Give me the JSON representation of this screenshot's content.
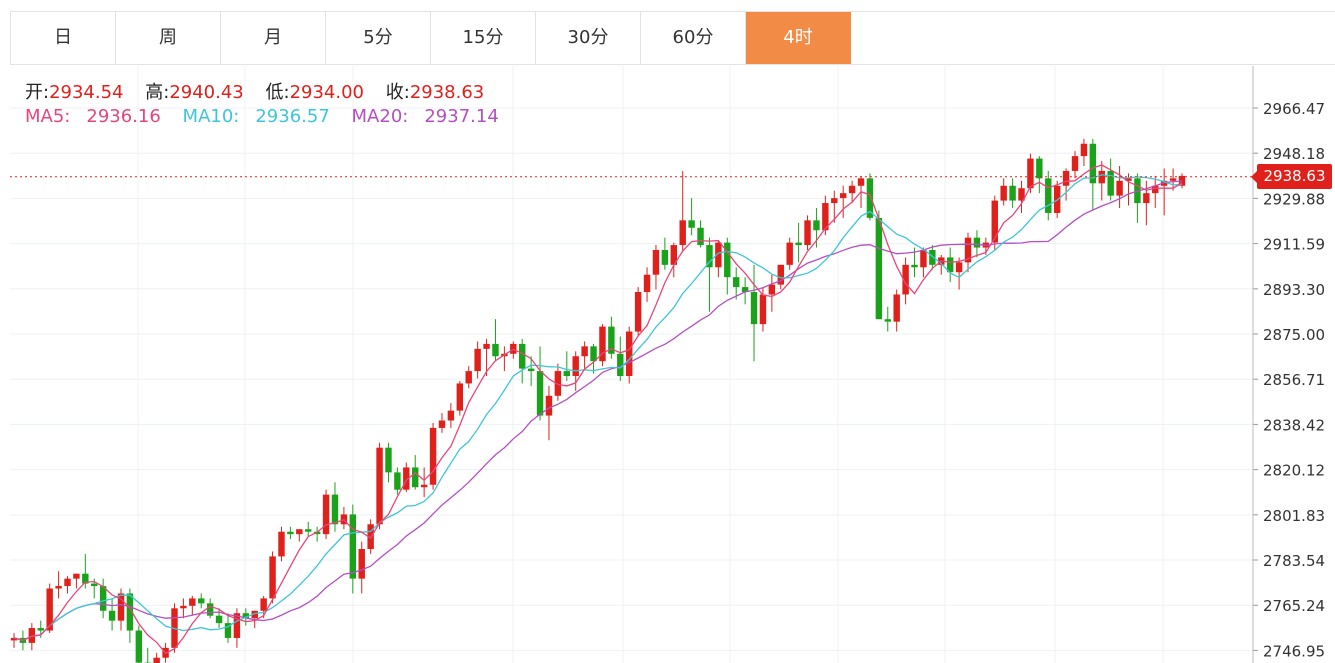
{
  "tabs": [
    {
      "label": "日",
      "active": false
    },
    {
      "label": "周",
      "active": false
    },
    {
      "label": "月",
      "active": false
    },
    {
      "label": "5分",
      "active": false
    },
    {
      "label": "15分",
      "active": false
    },
    {
      "label": "30分",
      "active": false
    },
    {
      "label": "60分",
      "active": false
    },
    {
      "label": "4时",
      "active": true
    }
  ],
  "ohlc_info": {
    "open_label": "开:",
    "open": "2934.54",
    "high_label": "高:",
    "high": "2940.43",
    "low_label": "低:",
    "low": "2934.00",
    "close_label": "收:",
    "close": "2938.63"
  },
  "ma_info": {
    "ma5_label": "MA5:",
    "ma5": "2936.16",
    "ma10_label": "MA10:",
    "ma10": "2936.57",
    "ma20_label": "MA20:",
    "ma20": "2937.14"
  },
  "current_price": "2938.63",
  "colors": {
    "up": "#e0201b",
    "down": "#1aa31a",
    "ma5": "#e8467a",
    "ma10": "#3ec6d6",
    "ma20": "#b44fc4",
    "accent": "#f28b45"
  },
  "chart_data": {
    "type": "candlestick",
    "y_axis_labels": [
      "2966.47",
      "2948.18",
      "2929.88",
      "2911.59",
      "2893.30",
      "2875.00",
      "2856.71",
      "2838.42",
      "2820.12",
      "2801.83",
      "2783.54",
      "2765.24",
      "2746.95"
    ],
    "ylim": [
      2742,
      2976
    ],
    "grid": true,
    "current_price": 2938.63,
    "candles": [
      [
        2751,
        2754,
        2748,
        2752
      ],
      [
        2752,
        2755,
        2747,
        2750
      ],
      [
        2750,
        2758,
        2747,
        2756
      ],
      [
        2756,
        2759,
        2752,
        2755
      ],
      [
        2755,
        2774,
        2754,
        2772
      ],
      [
        2772,
        2779,
        2768,
        2773
      ],
      [
        2773,
        2777,
        2770,
        2776
      ],
      [
        2776,
        2778,
        2772,
        2778
      ],
      [
        2778,
        2786,
        2772,
        2774
      ],
      [
        2774,
        2776,
        2768,
        2773
      ],
      [
        2773,
        2776,
        2760,
        2763
      ],
      [
        2763,
        2768,
        2755,
        2759
      ],
      [
        2759,
        2772,
        2755,
        2770
      ],
      [
        2770,
        2772,
        2750,
        2755
      ],
      [
        2755,
        2757,
        2740,
        2742
      ],
      [
        2742,
        2748,
        2736,
        2740
      ],
      [
        2740,
        2746,
        2737,
        2744
      ],
      [
        2744,
        2750,
        2742,
        2748
      ],
      [
        2748,
        2766,
        2746,
        2764
      ],
      [
        2764,
        2768,
        2760,
        2765
      ],
      [
        2765,
        2769,
        2761,
        2768
      ],
      [
        2768,
        2770,
        2764,
        2766
      ],
      [
        2766,
        2768,
        2760,
        2761
      ],
      [
        2761,
        2764,
        2756,
        2758
      ],
      [
        2758,
        2762,
        2750,
        2752
      ],
      [
        2752,
        2764,
        2748,
        2762
      ],
      [
        2762,
        2764,
        2757,
        2760
      ],
      [
        2760,
        2763,
        2756,
        2763
      ],
      [
        2763,
        2769,
        2760,
        2768
      ],
      [
        2768,
        2787,
        2766,
        2785
      ],
      [
        2785,
        2797,
        2783,
        2795
      ],
      [
        2795,
        2797,
        2792,
        2794
      ],
      [
        2794,
        2796,
        2791,
        2796
      ],
      [
        2796,
        2799,
        2793,
        2795
      ],
      [
        2795,
        2797,
        2791,
        2794
      ],
      [
        2794,
        2812,
        2792,
        2810
      ],
      [
        2810,
        2815,
        2795,
        2798
      ],
      [
        2798,
        2805,
        2796,
        2802
      ],
      [
        2802,
        2806,
        2770,
        2776
      ],
      [
        2776,
        2791,
        2770,
        2788
      ],
      [
        2788,
        2800,
        2786,
        2798
      ],
      [
        2798,
        2831,
        2796,
        2829
      ],
      [
        2829,
        2831,
        2815,
        2819
      ],
      [
        2819,
        2821,
        2810,
        2812
      ],
      [
        2812,
        2823,
        2811,
        2821
      ],
      [
        2821,
        2826,
        2812,
        2813
      ],
      [
        2813,
        2821,
        2809,
        2814
      ],
      [
        2814,
        2839,
        2812,
        2837
      ],
      [
        2837,
        2843,
        2835,
        2840
      ],
      [
        2840,
        2847,
        2837,
        2844
      ],
      [
        2844,
        2856,
        2842,
        2855
      ],
      [
        2855,
        2862,
        2853,
        2860
      ],
      [
        2860,
        2872,
        2857,
        2869
      ],
      [
        2869,
        2873,
        2858,
        2871
      ],
      [
        2871,
        2881,
        2864,
        2866
      ],
      [
        2866,
        2870,
        2860,
        2867
      ],
      [
        2867,
        2872,
        2865,
        2871
      ],
      [
        2871,
        2873,
        2855,
        2861
      ],
      [
        2861,
        2866,
        2854,
        2860
      ],
      [
        2860,
        2870,
        2840,
        2842
      ],
      [
        2842,
        2854,
        2832,
        2850
      ],
      [
        2850,
        2863,
        2848,
        2860
      ],
      [
        2860,
        2868,
        2856,
        2858
      ],
      [
        2858,
        2868,
        2852,
        2866
      ],
      [
        2866,
        2872,
        2861,
        2870
      ],
      [
        2870,
        2871,
        2859,
        2864
      ],
      [
        2864,
        2879,
        2862,
        2878
      ],
      [
        2878,
        2882,
        2865,
        2867
      ],
      [
        2867,
        2874,
        2856,
        2858
      ],
      [
        2858,
        2878,
        2855,
        2876
      ],
      [
        2876,
        2894,
        2874,
        2892
      ],
      [
        2892,
        2902,
        2888,
        2899
      ],
      [
        2899,
        2911,
        2893,
        2909
      ],
      [
        2909,
        2914,
        2901,
        2903
      ],
      [
        2903,
        2912,
        2898,
        2911
      ],
      [
        2911,
        2941,
        2908,
        2921
      ],
      [
        2921,
        2930,
        2915,
        2918
      ],
      [
        2918,
        2921,
        2910,
        2911
      ],
      [
        2911,
        2914,
        2884,
        2902
      ],
      [
        2902,
        2913,
        2898,
        2912
      ],
      [
        2912,
        2914,
        2891,
        2898
      ],
      [
        2898,
        2902,
        2889,
        2894
      ],
      [
        2894,
        2898,
        2887,
        2892
      ],
      [
        2892,
        2903,
        2864,
        2879
      ],
      [
        2879,
        2894,
        2876,
        2891
      ],
      [
        2891,
        2899,
        2884,
        2895
      ],
      [
        2895,
        2903,
        2893,
        2903
      ],
      [
        2903,
        2914,
        2901,
        2912
      ],
      [
        2912,
        2920,
        2904,
        2911
      ],
      [
        2911,
        2923,
        2909,
        2921
      ],
      [
        2921,
        2926,
        2910,
        2917
      ],
      [
        2917,
        2931,
        2915,
        2928
      ],
      [
        2928,
        2933,
        2920,
        2930
      ],
      [
        2930,
        2935,
        2922,
        2932
      ],
      [
        2932,
        2937,
        2928,
        2935
      ],
      [
        2935,
        2939,
        2926,
        2938
      ],
      [
        2938,
        2940,
        2921,
        2922
      ],
      [
        2922,
        2925,
        2881,
        2881
      ],
      [
        2881,
        2886,
        2876,
        2880
      ],
      [
        2880,
        2893,
        2876,
        2891
      ],
      [
        2891,
        2906,
        2887,
        2903
      ],
      [
        2903,
        2910,
        2898,
        2902
      ],
      [
        2902,
        2910,
        2898,
        2909
      ],
      [
        2909,
        2911,
        2901,
        2903
      ],
      [
        2903,
        2907,
        2899,
        2906
      ],
      [
        2906,
        2910,
        2896,
        2900
      ],
      [
        2900,
        2906,
        2893,
        2904
      ],
      [
        2904,
        2916,
        2900,
        2914
      ],
      [
        2914,
        2917,
        2906,
        2910
      ],
      [
        2910,
        2914,
        2907,
        2912
      ],
      [
        2912,
        2931,
        2909,
        2929
      ],
      [
        2929,
        2938,
        2927,
        2935
      ],
      [
        2935,
        2938,
        2926,
        2929
      ],
      [
        2929,
        2937,
        2924,
        2934
      ],
      [
        2934,
        2948,
        2932,
        2946
      ],
      [
        2946,
        2947,
        2932,
        2938
      ],
      [
        2938,
        2941,
        2921,
        2924
      ],
      [
        2924,
        2937,
        2922,
        2935
      ],
      [
        2935,
        2942,
        2929,
        2941
      ],
      [
        2941,
        2949,
        2938,
        2947
      ],
      [
        2947,
        2954,
        2943,
        2952
      ],
      [
        2952,
        2954,
        2925,
        2936
      ],
      [
        2936,
        2945,
        2929,
        2941
      ],
      [
        2941,
        2946,
        2929,
        2931
      ],
      [
        2931,
        2943,
        2926,
        2937
      ],
      [
        2937,
        2940,
        2927,
        2938
      ],
      [
        2938,
        2940,
        2920,
        2928
      ],
      [
        2928,
        2937,
        2919,
        2932
      ],
      [
        2932,
        2939,
        2926,
        2935
      ],
      [
        2935,
        2942,
        2923,
        2937
      ],
      [
        2937,
        2942,
        2933,
        2938
      ],
      [
        2935,
        2940,
        2934,
        2939
      ]
    ]
  }
}
